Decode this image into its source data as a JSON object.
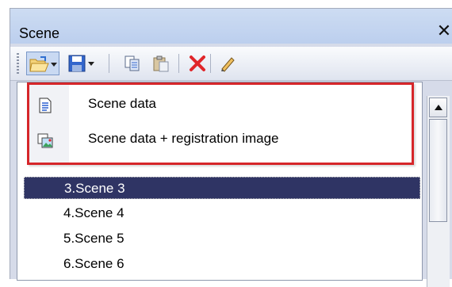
{
  "window": {
    "title": "Scene",
    "close_label": "✕"
  },
  "toolbar": {
    "buttons": [
      {
        "name": "open-folder-icon"
      },
      {
        "name": "save-icon"
      },
      {
        "name": "copy-icon"
      },
      {
        "name": "paste-icon"
      },
      {
        "name": "delete-icon"
      },
      {
        "name": "edit-pencil-icon"
      }
    ]
  },
  "dropdown_menu": {
    "items": [
      {
        "label": "Scene data",
        "icon": "document-icon"
      },
      {
        "label": "Scene data + registration image",
        "icon": "image-icon"
      }
    ],
    "highlight_color": "#d6262a"
  },
  "scene_list": {
    "items": [
      {
        "label": "3.Scene 3",
        "selected": true
      },
      {
        "label": "4.Scene 4",
        "selected": false
      },
      {
        "label": "5.Scene 5",
        "selected": false
      },
      {
        "label": "6.Scene 6",
        "selected": false
      }
    ],
    "selected_color": "#2f3464"
  }
}
